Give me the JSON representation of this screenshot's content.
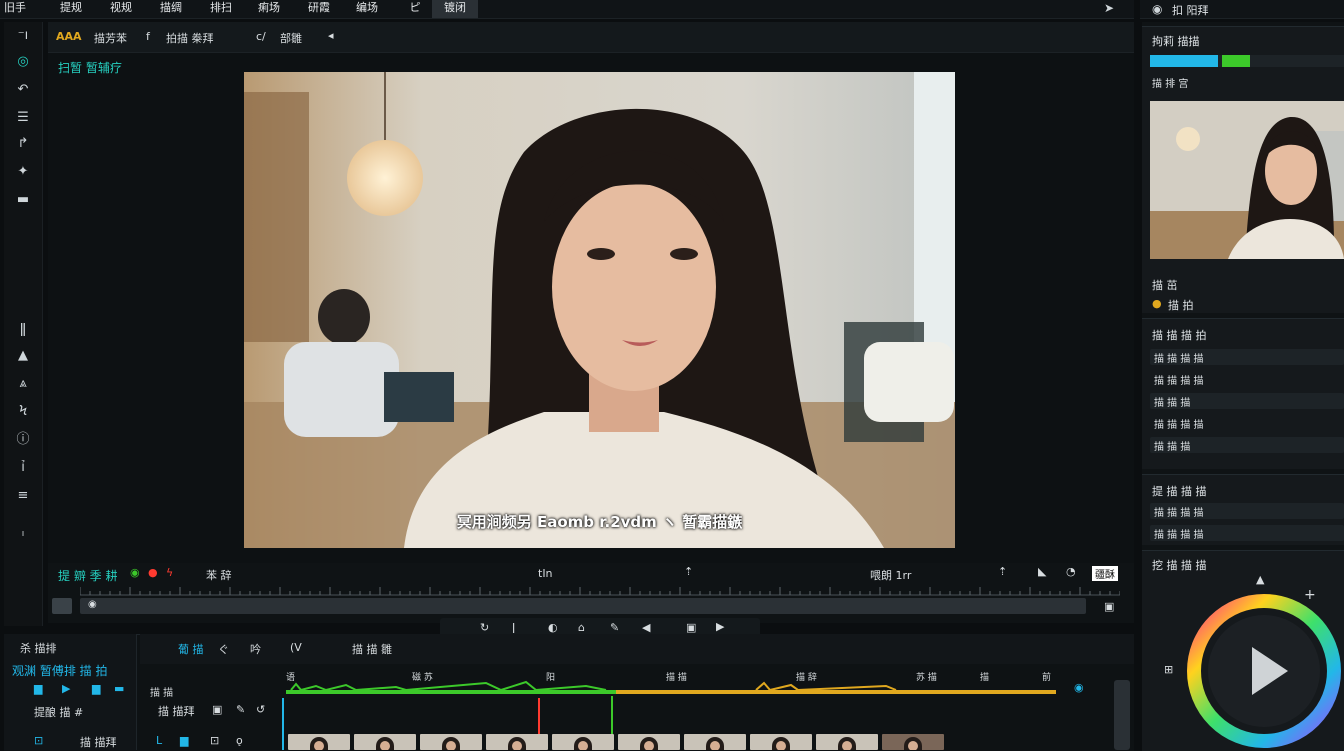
{
  "menu": [
    "旧手",
    "提规",
    "视规",
    "描绸",
    "排扫",
    "痢场",
    "研霞",
    "编场",
    "ピ",
    "镀闭"
  ],
  "menu_active_index": 9,
  "right_top": {
    "label": "扣 阳拜"
  },
  "left_toolbar": {
    "icons": [
      "minus-icon",
      "circle-icon",
      "undo-icon",
      "grid-icon",
      "pen-icon",
      "move-icon",
      "panel-icon",
      "split-icon",
      "layers-icon",
      "shapes-icon",
      "text-icon",
      "info-icon",
      "cursor-icon",
      "stack-icon",
      "dot-icon"
    ]
  },
  "toolbar2": {
    "labels": [
      "AAA",
      "描芳苯",
      "f",
      "拍描 桊拜",
      "c/",
      "部雛"
    ]
  },
  "viewer": {
    "title": "扫暂 暂辅疗",
    "subtitle": "冥用涧频另 Eaomb r.2vdm ヽ 暂霸描鏃"
  },
  "transport": {
    "left_label": "提 辧 季 耕",
    "mid_label_1": "苯 辞",
    "mid_label_2": "tIn",
    "right_label_1": "喂朗 1rr",
    "timecode_badge": "疆酥"
  },
  "timeline": {
    "left_title": "杀 描排",
    "left_subtitle": "观渊 暂傅排 描 拍",
    "track_label_1": "提酿 描 #",
    "track_label_2": "描 描拜",
    "track_label_3": "描 描",
    "header_labels": [
      "葡 描",
      "ぐ",
      "吟",
      "(V",
      "描 描 雛"
    ],
    "ruler_labels": [
      "语",
      "磁 苏",
      "阳",
      "描 描",
      "描 辞",
      "苏 描",
      "描",
      "前"
    ]
  },
  "right_panel": {
    "section1_title": "拘莉 描描",
    "section1_sub": "描 排 宫",
    "preview_label_1": "描 茁",
    "preview_label_2": "描 拍",
    "section2_title": "描 描 描 拍",
    "section2_rows": [
      "描 描 描 描",
      "描 描 描 描",
      "描 描 描",
      "描 描 描 描",
      "描 描 描"
    ],
    "section3_title": "提 描 描 描",
    "section3_rows": [
      "描 描 描 描",
      "描 描 描 描"
    ],
    "section4_title": "挖 描 描 描"
  },
  "colors": {
    "accent_teal": "#26d0c0",
    "accent_cyan": "#22b7e8",
    "audio_green": "#3cc92a",
    "audio_yellow": "#e0a81f",
    "playhead_red": "#ff3b30"
  }
}
